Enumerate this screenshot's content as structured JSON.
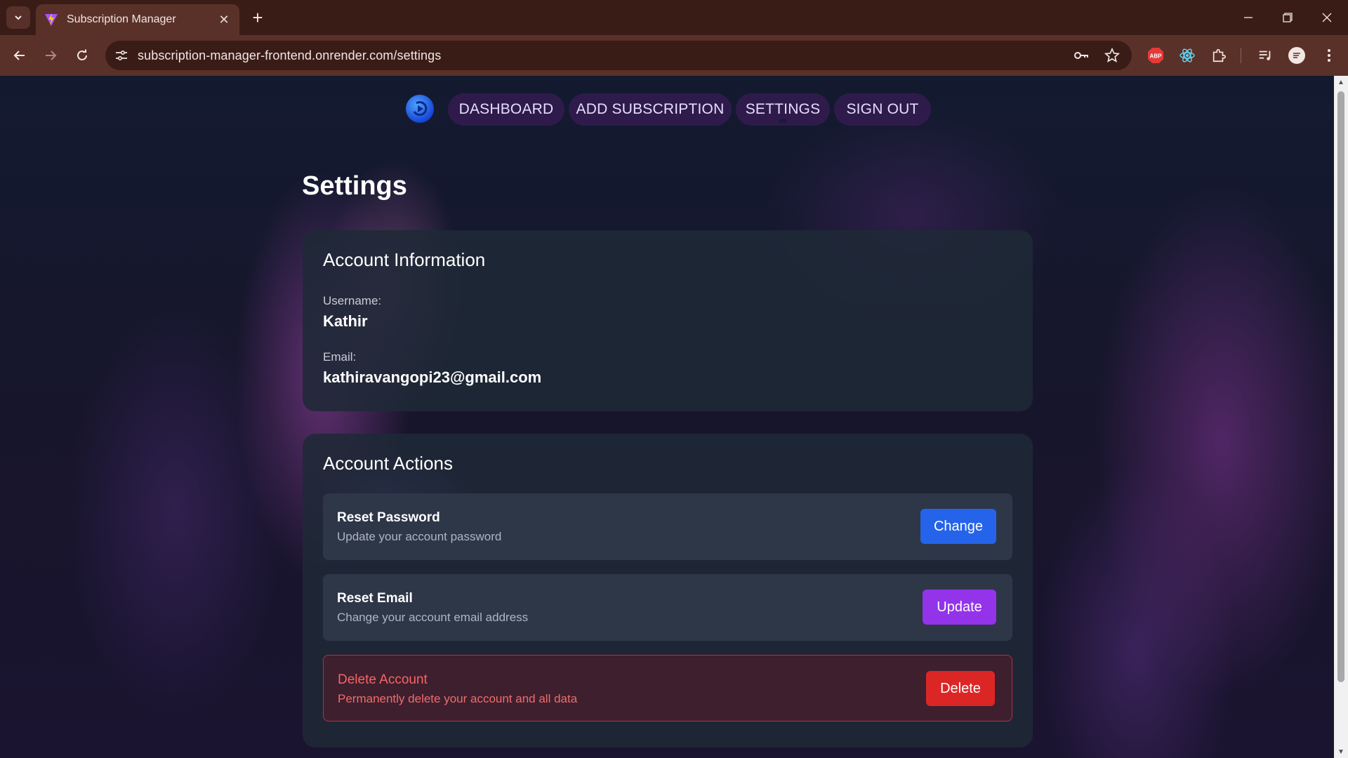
{
  "browser": {
    "tab_title": "Subscription Manager",
    "url": "subscription-manager-frontend.onrender.com/settings",
    "extension_abp_label": "ABP"
  },
  "nav": {
    "items": [
      {
        "label": "DASHBOARD"
      },
      {
        "label": "ADD SUBSCRIPTION"
      },
      {
        "label": "SETTINGS"
      },
      {
        "label": "SIGN OUT"
      }
    ],
    "active": "SETTINGS"
  },
  "page": {
    "title": "Settings"
  },
  "account_info": {
    "title": "Account Information",
    "username_label": "Username:",
    "username": "Kathir",
    "email_label": "Email:",
    "email": "kathiravangopi23@gmail.com"
  },
  "account_actions": {
    "title": "Account Actions",
    "reset_password": {
      "title": "Reset Password",
      "description": "Update your account password",
      "button": "Change",
      "button_color": "#2563eb"
    },
    "reset_email": {
      "title": "Reset Email",
      "description": "Change your account email address",
      "button": "Update",
      "button_color": "#9333ea"
    },
    "delete_account": {
      "title": "Delete Account",
      "description": "Permanently delete your account and all data",
      "button": "Delete",
      "button_color": "#dc2626"
    }
  }
}
